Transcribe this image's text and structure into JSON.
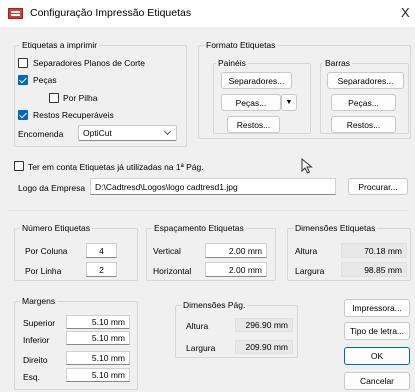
{
  "window": {
    "title": "Configuração Impressão Etiquetas",
    "close_glyph": "X"
  },
  "etiquetas": {
    "legend": "Etiquetas a imprimir",
    "separadores": {
      "label": "Separadores Planos de Corte",
      "checked": false
    },
    "pecas": {
      "label": "Peças",
      "checked": true
    },
    "por_pilha": {
      "label": "Por Pilha",
      "checked": false
    },
    "restos": {
      "label": "Restos Recuperáveis",
      "checked": true
    },
    "encomenda_label": "Encomenda",
    "encomenda_value": "OptiCut"
  },
  "formato": {
    "legend": "Formato Etiquetas",
    "paineis": {
      "title": "Painéis",
      "separadores": "Separadores...",
      "pecas": "Peças...",
      "restos": "Restos..."
    },
    "barras": {
      "title": "Barras",
      "separadores": "Separadores...",
      "pecas": "Peças...",
      "restos": "Restos..."
    }
  },
  "ter_em_conta": {
    "label": "Ter em conta Etiquetas já utilizadas na 1ª Pág.",
    "checked": false
  },
  "logo": {
    "label": "Logo da Empresa",
    "path": "D:\\Cadtresd\\Logos\\logo cadtresd1.jpg",
    "procurar": "Procurar..."
  },
  "numero": {
    "legend": "Número Etiquetas",
    "por_coluna_label": "Por Coluna",
    "por_coluna": "4",
    "por_linha_label": "Por Linha",
    "por_linha": "2"
  },
  "espacamento": {
    "legend": "Espaçamento Etiquetas",
    "vertical_label": "Vertical",
    "vertical": "2.00 mm",
    "horizontal_label": "Horizontal",
    "horizontal": "2.00 mm"
  },
  "dimensoes_etiquetas": {
    "legend": "Dimensões Etiquetas",
    "altura_label": "Altura",
    "altura": "70.18 mm",
    "largura_label": "Largura",
    "largura": "98.85 mm"
  },
  "margens": {
    "legend": "Margens",
    "superior_label": "Superior",
    "superior": "5.10 mm",
    "inferior_label": "Inferior",
    "inferior": "5.10 mm",
    "direito_label": "Direito",
    "direito": "5.10 mm",
    "esq_label": "Esq.",
    "esq": "5.10 mm"
  },
  "dimensoes_pag": {
    "legend": "Dimensões Pág.",
    "altura_label": "Altura",
    "altura": "296.90 mm",
    "largura_label": "Largura",
    "largura": "209.90 mm"
  },
  "buttons": {
    "impressora": "Impressora...",
    "tipo_letra": "Tipo de letra...",
    "ok": "OK",
    "cancelar": "Cancelar"
  },
  "colors": {
    "accent": "#0067c0",
    "app_icon": "#d63b3b"
  }
}
